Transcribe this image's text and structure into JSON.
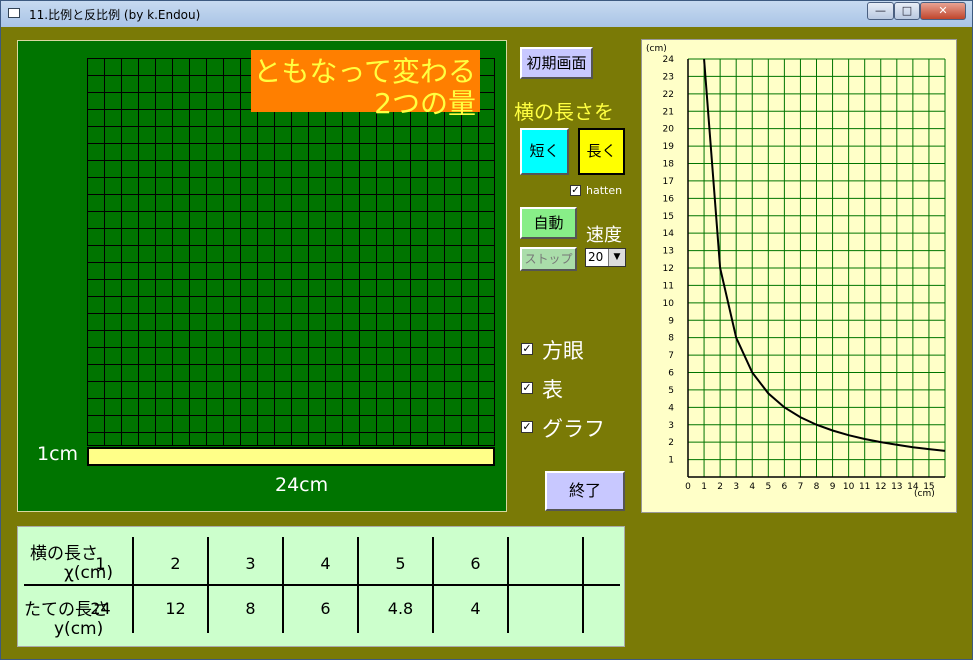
{
  "window": {
    "title": "11.比例と反比例 (by k.Endou)",
    "minimize": "—",
    "maximize": "□",
    "close": "✕"
  },
  "canvas": {
    "title_line1": "ともなって変わる",
    "title_line2": "2つの量",
    "height_label": "1cm",
    "width_label": "24cm"
  },
  "controls": {
    "init_label": "初期画面",
    "width_heading": "横の長さを",
    "short_label": "短く",
    "long_label": "長く",
    "hatten_label": "hatten",
    "hatten_checked": true,
    "auto_label": "自動",
    "stop_label": "ストップ",
    "speed_label": "速度",
    "speed_value": "20",
    "grid_label": "方眼",
    "table_label": "表",
    "graph_label": "グラフ",
    "exit_label": "終了"
  },
  "table": {
    "row1_label_a": "横の長さ",
    "row1_label_b": "χ(cm)",
    "row2_label_a": "たての長さ",
    "row2_label_b": "y(cm)",
    "x_values": [
      "1",
      "2",
      "3",
      "4",
      "5",
      "6",
      ""
    ],
    "y_values": [
      "24",
      "12",
      "8",
      "6",
      "4.8",
      "4",
      ""
    ]
  },
  "chart_data": {
    "type": "line",
    "title": "",
    "xlabel": "(cm)",
    "ylabel": "(cm)",
    "xlim": [
      0,
      16
    ],
    "ylim": [
      0,
      24
    ],
    "grid": true,
    "x_ticks": [
      0,
      1,
      2,
      3,
      4,
      5,
      6,
      7,
      8,
      9,
      10,
      11,
      12,
      13,
      14,
      15
    ],
    "y_ticks": [
      1,
      2,
      3,
      4,
      5,
      6,
      7,
      8,
      9,
      10,
      11,
      12,
      13,
      14,
      15,
      16,
      17,
      18,
      19,
      20,
      21,
      22,
      23,
      24
    ],
    "series": [
      {
        "x": [
          1,
          2,
          3,
          4,
          5,
          6,
          7,
          8,
          9,
          10,
          11,
          12,
          13,
          14,
          15,
          16
        ],
        "values": [
          24,
          12,
          8,
          6,
          4.8,
          4,
          3.43,
          3,
          2.67,
          2.4,
          2.18,
          2,
          1.85,
          1.71,
          1.6,
          1.5
        ]
      }
    ]
  },
  "colors": {
    "background": "#7a7a06",
    "grid_panel": "#007400",
    "title_box": "#ff7f00",
    "title_text": "#ffff40",
    "rectangle": "#ffff88",
    "graph_bg": "#ffffc8",
    "graph_grid": "#007400",
    "table_bg": "#ccffcc"
  }
}
